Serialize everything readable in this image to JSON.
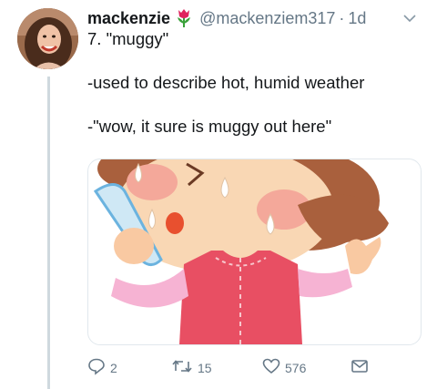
{
  "tweet": {
    "display_name": "mackenzie",
    "handle": "@mackenziem317",
    "separator": "·",
    "time": "1d",
    "lines": [
      "7. \"muggy\"",
      "",
      "-used to describe hot, humid weather",
      "",
      "-\"wow, it sure is muggy out here\""
    ]
  },
  "actions": {
    "reply_count": "2",
    "retweet_count": "15",
    "like_count": "576"
  },
  "icons": {
    "name_emoji": "tulip-icon",
    "menu": "chevron-down-icon",
    "reply": "reply-icon",
    "retweet": "retweet-icon",
    "like": "heart-icon",
    "dm": "envelope-icon"
  },
  "colors": {
    "text_primary": "#14171a",
    "text_secondary": "#657786",
    "thread_line": "#cfd9de"
  }
}
